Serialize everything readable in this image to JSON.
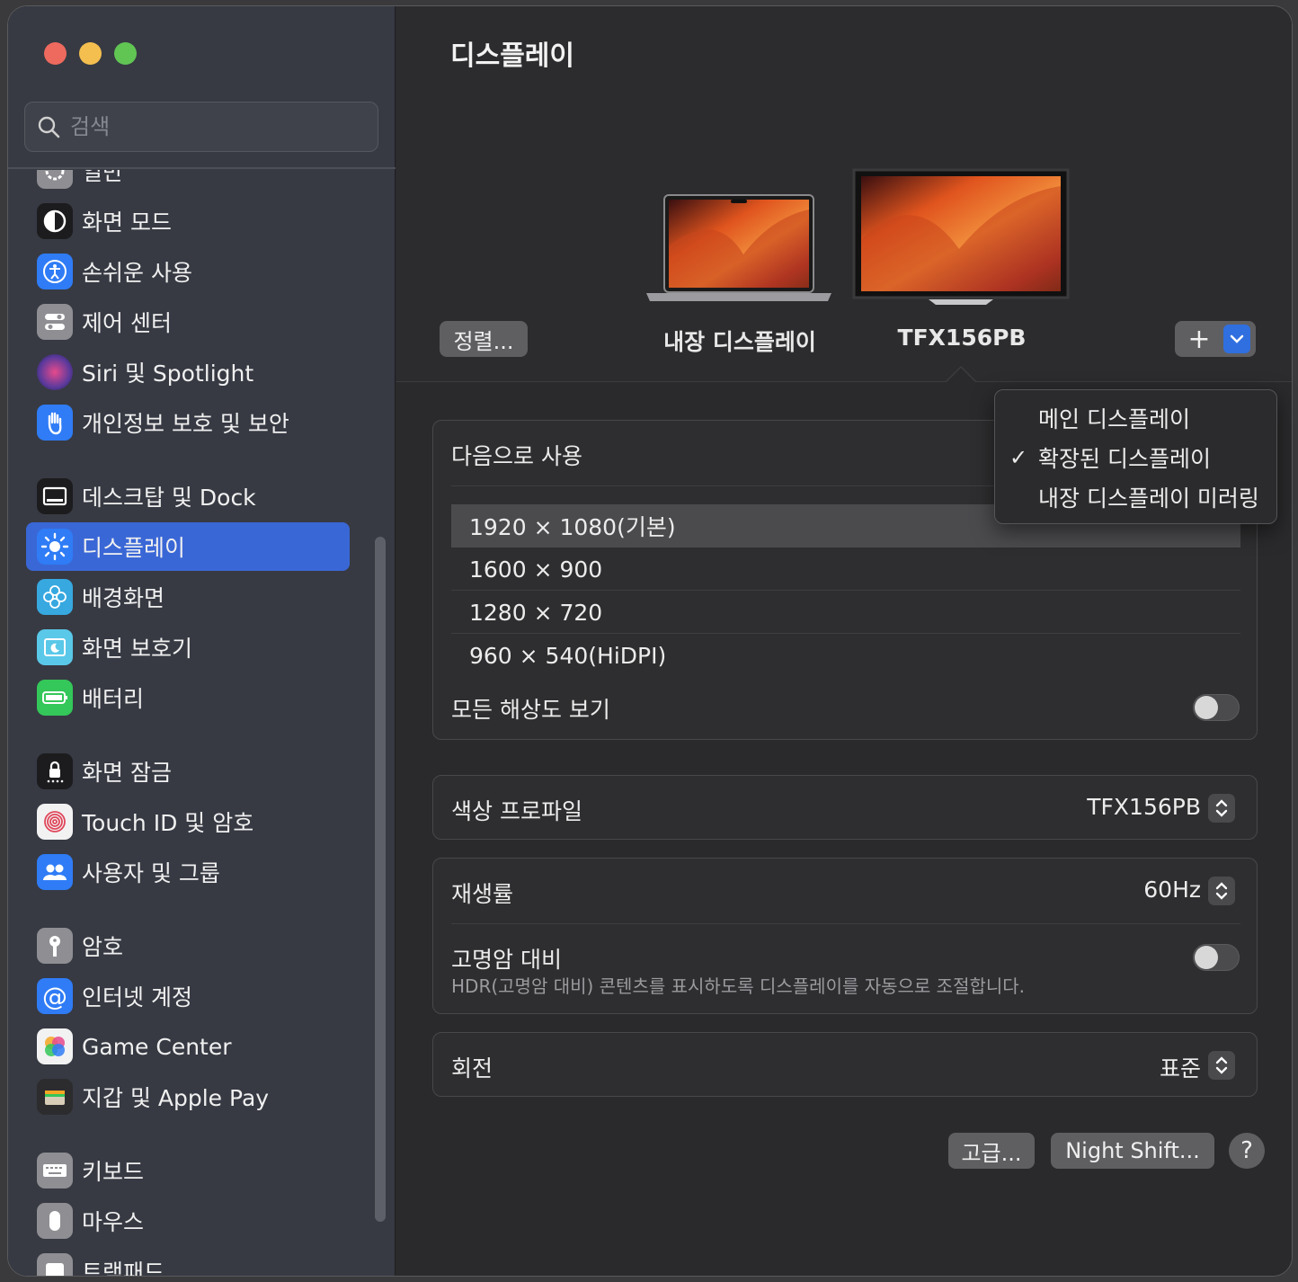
{
  "sidebar": {
    "search_placeholder": "검색",
    "partial_top_label": "일반",
    "items": [
      {
        "label": "화면 모드",
        "icon": "appearance-icon",
        "color": "#1c1c1e"
      },
      {
        "label": "손쉬운 사용",
        "icon": "accessibility-icon",
        "color": "#2f7cf6"
      },
      {
        "label": "제어 센터",
        "icon": "control-center-icon",
        "color": "#8e8e93"
      },
      {
        "label": "Siri 및 Spotlight",
        "icon": "siri-icon",
        "color": "#5b3a9c"
      },
      {
        "label": "개인정보 보호 및 보안",
        "icon": "hand-icon",
        "color": "#2f7cf6"
      },
      {
        "label": "데스크탑 및 Dock",
        "icon": "dock-icon",
        "color": "#1c1c1e"
      },
      {
        "label": "디스플레이",
        "icon": "sun-icon",
        "color": "#2f7cf6",
        "active": true
      },
      {
        "label": "배경화면",
        "icon": "flower-icon",
        "color": "#37a8e0"
      },
      {
        "label": "화면 보호기",
        "icon": "screensaver-icon",
        "color": "#5ac8e8"
      },
      {
        "label": "배터리",
        "icon": "battery-icon",
        "color": "#34c759"
      },
      {
        "label": "화면 잠금",
        "icon": "lock-icon",
        "color": "#1c1c1e"
      },
      {
        "label": "Touch ID 및 암호",
        "icon": "fingerprint-icon",
        "color": "#f2f2f2"
      },
      {
        "label": "사용자 및 그룹",
        "icon": "users-icon",
        "color": "#2f7cf6"
      },
      {
        "label": "암호",
        "icon": "key-icon",
        "color": "#8e8e93"
      },
      {
        "label": "인터넷 계정",
        "icon": "at-icon",
        "color": "#2f7cf6"
      },
      {
        "label": "Game Center",
        "icon": "game-center-icon",
        "color": "#f2f2f2"
      },
      {
        "label": "지갑 및 Apple Pay",
        "icon": "wallet-icon",
        "color": "#2c2c2e"
      },
      {
        "label": "키보드",
        "icon": "keyboard-icon",
        "color": "#8e8e93"
      },
      {
        "label": "마우스",
        "icon": "mouse-icon",
        "color": "#8e8e93"
      },
      {
        "label": "트랙패드",
        "icon": "trackpad-icon",
        "color": "#8e8e93"
      }
    ]
  },
  "main": {
    "title": "디스플레이",
    "arrange_button": "정렬...",
    "displays": [
      {
        "label": "내장 디스플레이"
      },
      {
        "label": "TFX156PB"
      }
    ],
    "add_button": "+",
    "use_as_label": "다음으로 사용",
    "resolutions": [
      "1920 × 1080(기본)",
      "1600 × 900",
      "1280 × 720",
      "960 × 540(HiDPI)"
    ],
    "show_all_label": "모든 해상도 보기",
    "color_profile": {
      "label": "색상 프로파일",
      "value": "TFX156PB"
    },
    "refresh_rate": {
      "label": "재생률",
      "value": "60Hz"
    },
    "hdr": {
      "label": "고명암 대비",
      "description": "HDR(고명암 대비) 콘텐츠를 표시하도록 디스플레이를 자동으로 조절합니다."
    },
    "rotation": {
      "label": "회전",
      "value": "표준"
    },
    "advanced_button": "고급...",
    "night_shift_button": "Night Shift...",
    "help_button": "?"
  },
  "menu": {
    "items": [
      {
        "label": "메인 디스플레이",
        "checked": false
      },
      {
        "label": "확장된 디스플레이",
        "checked": true
      },
      {
        "label": "내장 디스플레이 미러링",
        "checked": false
      }
    ],
    "check_mark": "✓"
  },
  "colors": {
    "accent": "#3a67d6",
    "window_bg": "#2a2a2c",
    "sidebar_bg": "#373a43"
  }
}
